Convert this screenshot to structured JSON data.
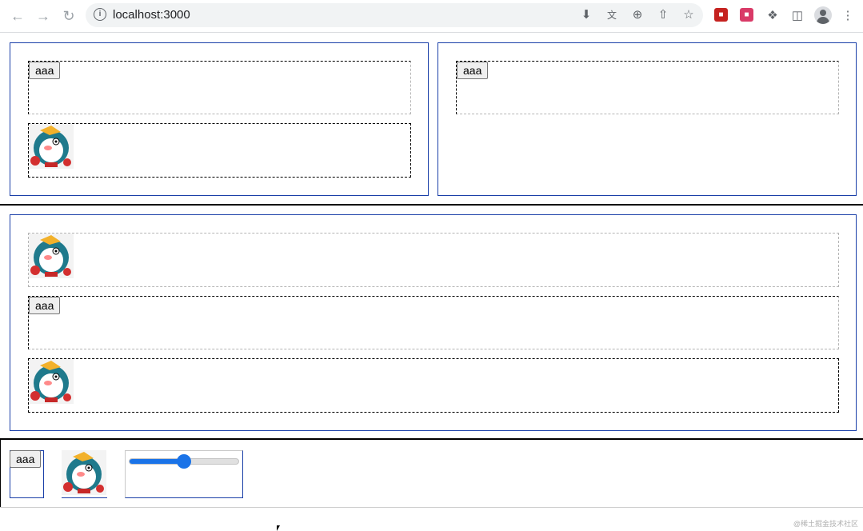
{
  "browser": {
    "url": "localhost:3000",
    "icons": {
      "back": "back-arrow-icon",
      "forward": "forward-arrow-icon",
      "reload": "reload-icon",
      "info": "info-icon",
      "install": "install-app-icon",
      "translate": "translate-icon",
      "zoom": "zoom-icon",
      "share": "share-icon",
      "bookmark": "star-icon",
      "extensions": "puzzle-icon",
      "sidepanel": "side-panel-icon",
      "profile": "profile-icon",
      "menu": "kebab-menu-icon"
    }
  },
  "page": {
    "button_label": "aaa",
    "image_alt": "doraemon-sticker",
    "slider_value": 0.5
  },
  "watermark": "@稀土掘金技术社区",
  "colors": {
    "panel_border": "#1a3fa8",
    "accent": "#1a73e8",
    "ext1": "#c5221f",
    "ext2": "#d93a67"
  }
}
